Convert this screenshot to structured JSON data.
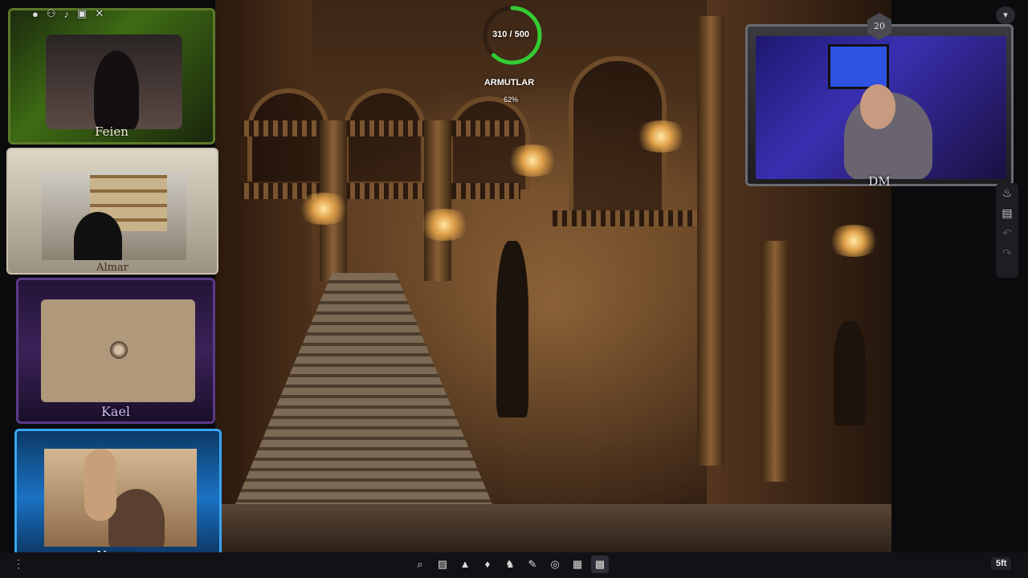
{
  "hp": {
    "current_max": "310 / 500",
    "name": "ARMUTLAR",
    "percent": "62%",
    "fraction": 0.62,
    "color": "#33cc33"
  },
  "players": [
    {
      "name": "Feien"
    },
    {
      "name": "Almar"
    },
    {
      "name": "Kael"
    },
    {
      "name": "Vesper"
    }
  ],
  "dm": {
    "name": "DM",
    "die": "20"
  },
  "toolbar": {
    "grid_scale": "5ft",
    "icons": [
      "search-icon",
      "image-icon",
      "terrain-icon",
      "light-icon",
      "creature-icon",
      "draw-icon",
      "sync-icon",
      "notes-icon",
      "grid-icon"
    ]
  },
  "top_icons": [
    "user-icon",
    "users-icon",
    "mic-icon",
    "camera-off-icon",
    "close-icon"
  ],
  "right_tools": [
    "fire-icon",
    "chart-icon",
    "undo-icon",
    "redo-icon"
  ]
}
